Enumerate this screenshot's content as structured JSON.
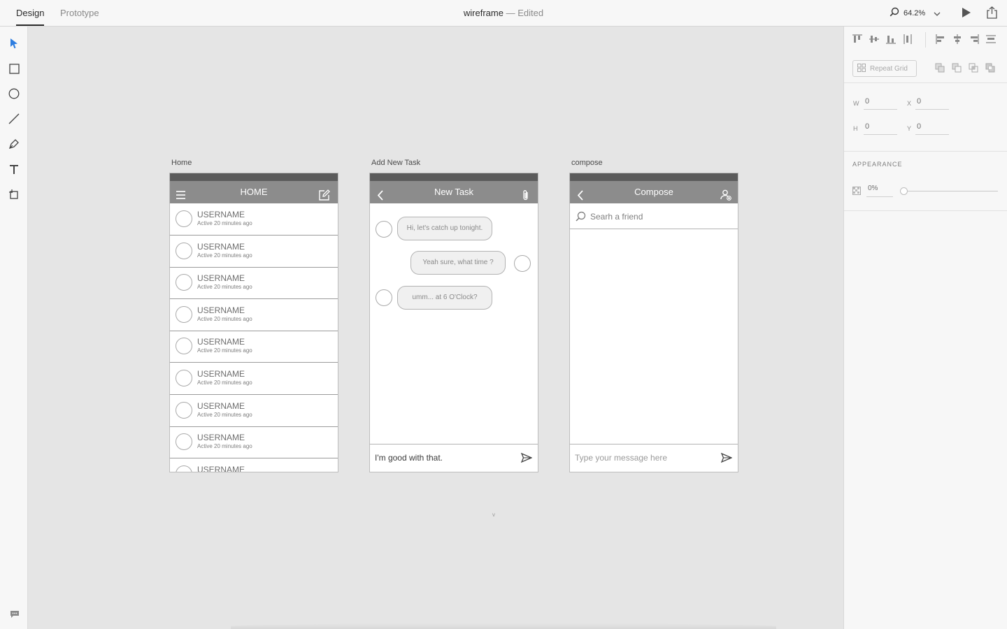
{
  "topbar": {
    "tabs": [
      {
        "label": "Design",
        "active": true
      },
      {
        "label": "Prototype",
        "active": false
      }
    ],
    "doc_name": "wireframe",
    "doc_status": " — Edited",
    "zoom": "64.2%"
  },
  "left_tools": [
    "select-tool-icon",
    "rectangle-tool-icon",
    "ellipse-tool-icon",
    "line-tool-icon",
    "pen-tool-icon",
    "text-tool-icon",
    "artboard-tool-icon"
  ],
  "right_panel": {
    "repeat_grid_label": "Repeat Grid",
    "fields": {
      "w_label": "W",
      "w_value": "0",
      "x_label": "X",
      "x_value": "0",
      "h_label": "H",
      "h_value": "0",
      "y_label": "Y",
      "y_value": "0"
    },
    "appearance_label": "APPEARANCE",
    "opacity_value": "0%",
    "opacity_level": 0
  },
  "artboards": {
    "home": {
      "label": "Home",
      "title": "HOME",
      "rows": [
        {
          "name": "USERNAME",
          "status": "Active 20 minutes ago"
        },
        {
          "name": "USERNAME",
          "status": "Active 20 minutes ago"
        },
        {
          "name": "USERNAME",
          "status": "Active 20 minutes ago"
        },
        {
          "name": "USERNAME",
          "status": "Active 20 minutes ago"
        },
        {
          "name": "USERNAME",
          "status": "Active 20 minutes ago"
        },
        {
          "name": "USERNAME",
          "status": "Active 20 minutes ago"
        },
        {
          "name": "USERNAME",
          "status": "Active 20 minutes ago"
        },
        {
          "name": "USERNAME",
          "status": "Active 20 minutes ago"
        },
        {
          "name": "USERNAME",
          "status": ""
        }
      ]
    },
    "task": {
      "label": "Add New Task",
      "title": "New Task",
      "messages": [
        {
          "text": "Hi, let's catch up tonight.",
          "side": "left"
        },
        {
          "text": "Yeah sure, what time ?",
          "side": "right"
        },
        {
          "text": "umm... at 6 O'Clock?",
          "side": "left"
        }
      ],
      "input_value": "I'm good with that."
    },
    "compose": {
      "label": "compose",
      "title": "Compose",
      "search_placeholder": "Searh a friend",
      "message_placeholder": "Type your message here"
    }
  },
  "colors": {
    "statusbar": "#5b5b5b",
    "navbar": "#8c8c8c",
    "canvas": "#e5e5e5",
    "accent": "#2d7de0"
  }
}
